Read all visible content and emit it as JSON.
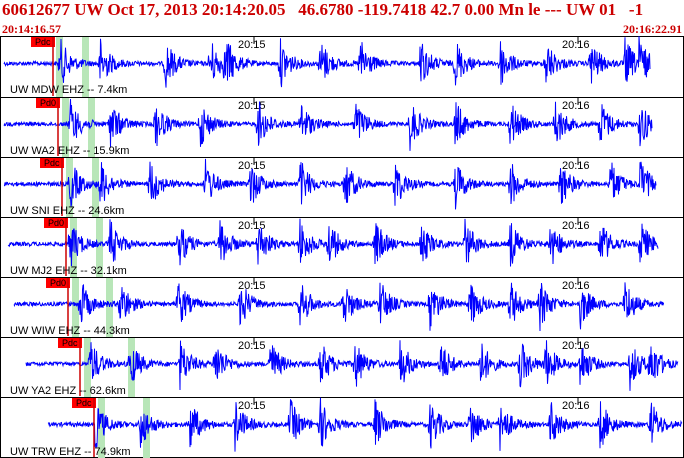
{
  "header": {
    "title": "60612677 UW Oct 17, 2013 20:14:20.05   46.6780 -119.7418 42.7 0.00 Mn le --- UW 01   -1",
    "start_time": "20:14:16.57",
    "end_time": "20:16:22.91"
  },
  "colors": {
    "trace": "#0000ff",
    "pick_box": "#ff0000",
    "pick_line": "#cc0000",
    "window_band": "#b8e6b8",
    "frame": "#000000",
    "title": "#cc0000"
  },
  "time_marks": [
    "20:15",
    "20:16"
  ],
  "channels": [
    {
      "label": "UW MDW EHZ -- 7.4km",
      "pick": "Pdc"
    },
    {
      "label": "UW WA2 EHZ -- 15.9km",
      "pick": "Pd0"
    },
    {
      "label": "UW SNI EHZ -- 24.6km",
      "pick": "Pdc"
    },
    {
      "label": "UW MJ2 EHZ -- 32.1km",
      "pick": "Pd0"
    },
    {
      "label": "UW WIW EHZ -- 44.3km",
      "pick": "Pd0"
    },
    {
      "label": "UW YA2 EHZ -- 62.6km",
      "pick": "Pdc"
    },
    {
      "label": "UW TRW EHZ -- 74.9km",
      "pick": "Pdc"
    }
  ]
}
